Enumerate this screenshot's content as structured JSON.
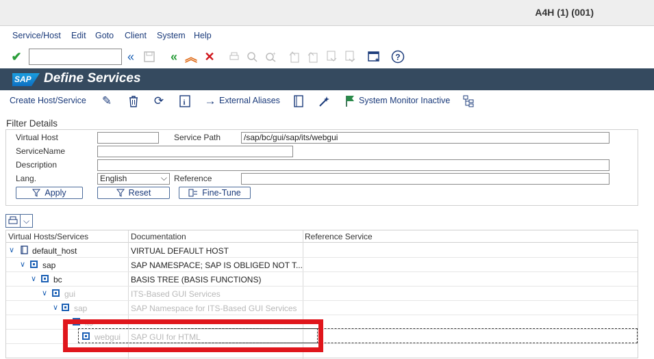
{
  "window": {
    "system": "A4H (1) (001)"
  },
  "menu": [
    "Service/Host",
    "Edit",
    "Goto",
    "Client",
    "System",
    "Help"
  ],
  "header": {
    "title": "Define Services",
    "logo": "SAP"
  },
  "appbar": {
    "create": "Create Host/Service",
    "external_aliases": "External Aliases",
    "monitor": "System Monitor Inactive"
  },
  "filter": {
    "title": "Filter Details",
    "virtual_host_label": "Virtual Host",
    "virtual_host_value": "",
    "service_path_label": "Service Path",
    "service_path_value": "/sap/bc/gui/sap/its/webgui",
    "service_name_label": "ServiceName",
    "description_label": "Description",
    "lang_label": "Lang.",
    "lang_value": "English",
    "reference_label": "Reference",
    "apply": "Apply",
    "reset": "Reset",
    "fine_tune": "Fine-Tune"
  },
  "tree": {
    "columns": [
      "Virtual Hosts/Services",
      "Documentation",
      "Reference Service"
    ],
    "rows": [
      {
        "name": "default_host",
        "doc": "VIRTUAL DEFAULT HOST"
      },
      {
        "name": "sap",
        "doc": "SAP NAMESPACE; SAP IS OBLIGED NOT T..."
      },
      {
        "name": "bc",
        "doc": "BASIS TREE (BASIS FUNCTIONS)"
      },
      {
        "name": "gui",
        "doc": "ITS-Based GUI Services"
      },
      {
        "name": "sap",
        "doc": "SAP Namespace for ITS-Based GUI Services"
      },
      {
        "name": "its",
        "doc": ""
      },
      {
        "name": "webgui",
        "doc": "SAP GUI for HTML"
      }
    ]
  },
  "colors": {
    "banner": "#354a5f",
    "link": "#1a3a7a",
    "highlight": "#e0161c"
  }
}
